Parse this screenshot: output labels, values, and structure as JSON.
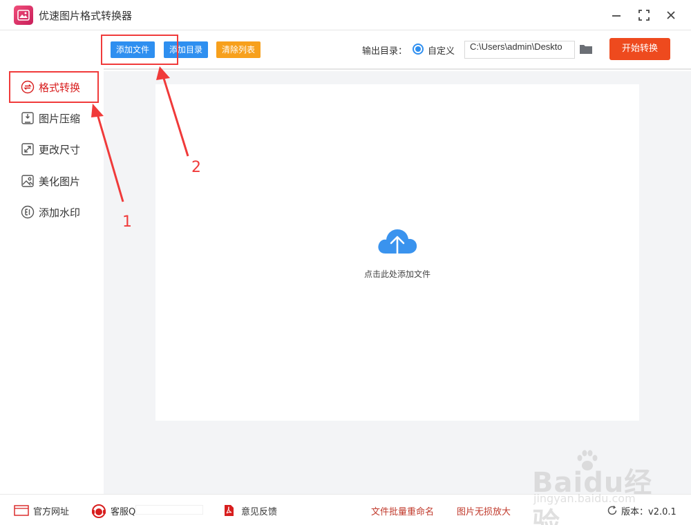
{
  "app": {
    "title": "优速图片格式转换器"
  },
  "toolbar": {
    "add_file": "添加文件",
    "add_dir": "添加目录",
    "clear_list": "清除列表",
    "output_label": "输出目录：",
    "custom_label": "自定义",
    "output_path": "C:\\Users\\admin\\Deskto",
    "start": "开始转换"
  },
  "sidebar": {
    "items": [
      {
        "label": "格式转换",
        "icon": "convert-icon",
        "active": true
      },
      {
        "label": "图片压缩",
        "icon": "compress-icon"
      },
      {
        "label": "更改尺寸",
        "icon": "resize-icon"
      },
      {
        "label": "美化图片",
        "icon": "beautify-icon"
      },
      {
        "label": "添加水印",
        "icon": "watermark-icon"
      }
    ]
  },
  "main": {
    "drop_hint": "点击此处添加文件"
  },
  "footer": {
    "website": "官方网址",
    "service": "客服Q",
    "feedback": "意见反馈",
    "batch_rename": "文件批量重命名",
    "lossless_enlarge": "图片无损放大",
    "version": "版本：v2.0.1"
  },
  "annotations": {
    "one": "1",
    "two": "2"
  },
  "watermark": {
    "brand": "Baidu经验",
    "url": "jingyan.baidu.com"
  },
  "colors": {
    "accent_blue": "#2e8ff0",
    "accent_orange": "#f7a01c",
    "start_red": "#ee4a1e",
    "active_red": "#d81e1e",
    "annotation_red": "#f03a3a"
  }
}
